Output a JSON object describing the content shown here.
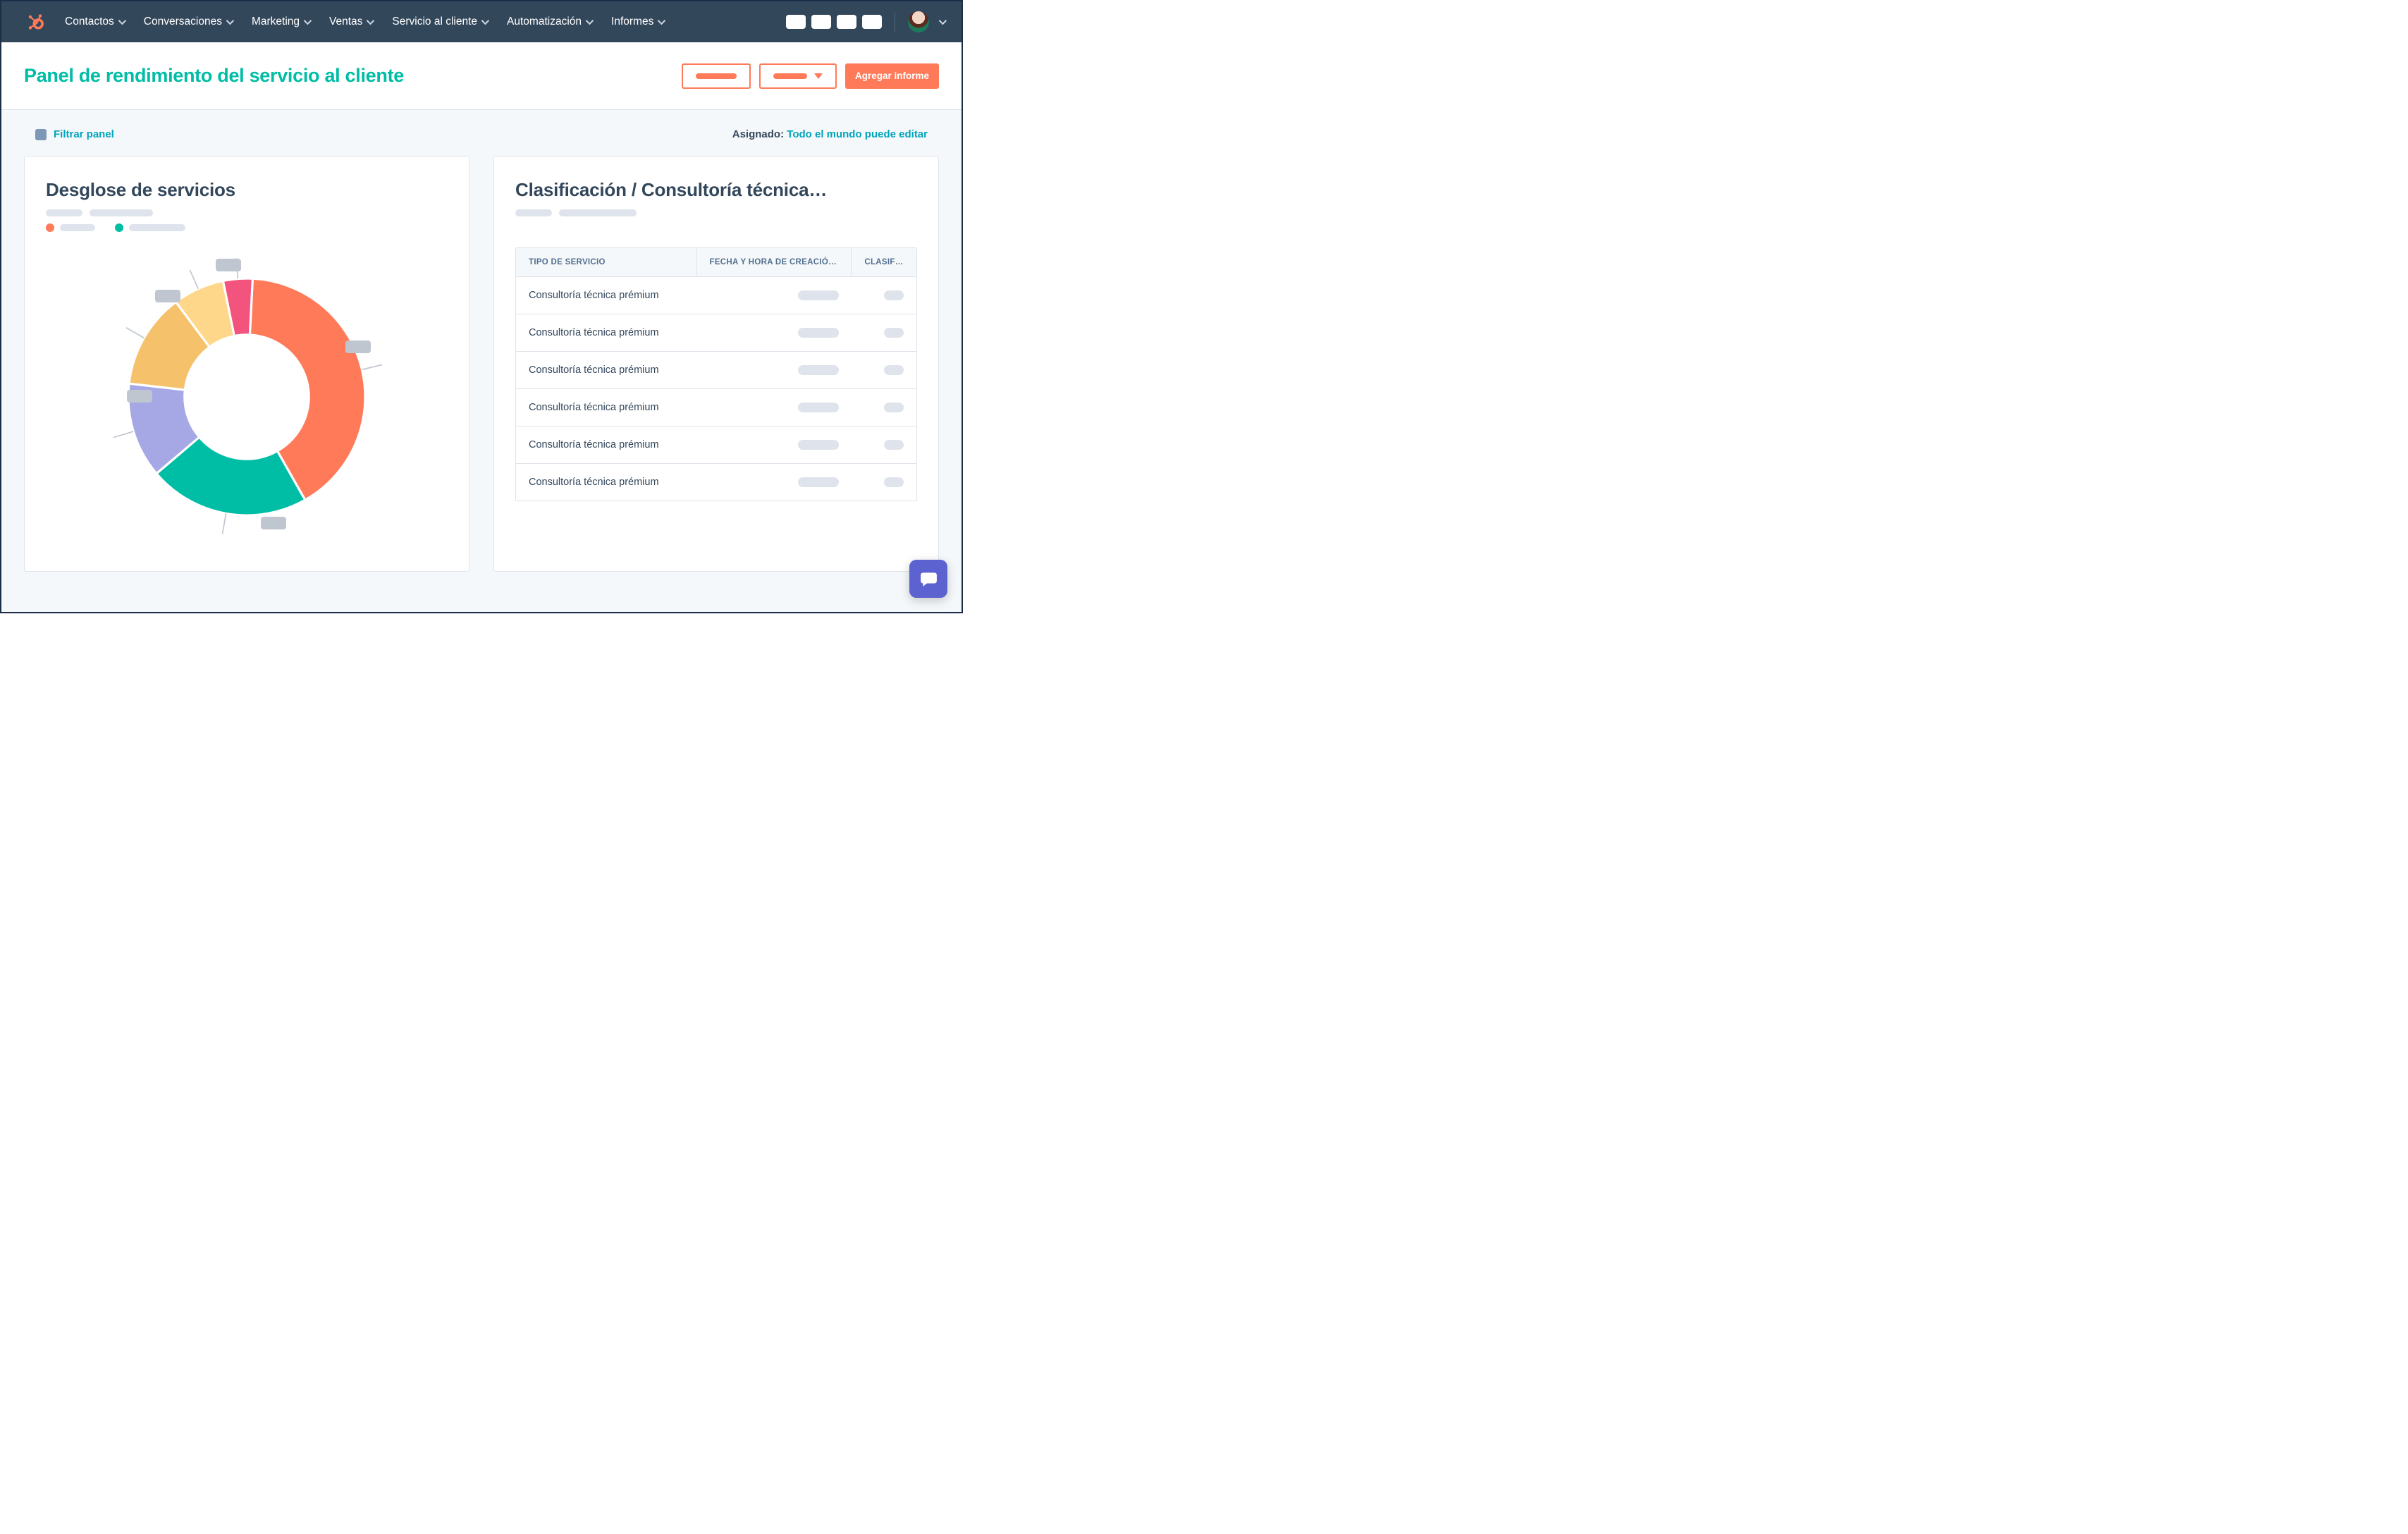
{
  "colors": {
    "accent": "#ff7a59",
    "teal": "#00bda5",
    "link": "#00a4bd",
    "navbg": "#33475b"
  },
  "nav": {
    "items": [
      {
        "label": "Contactos"
      },
      {
        "label": "Conversaciones"
      },
      {
        "label": "Marketing"
      },
      {
        "label": "Ventas"
      },
      {
        "label": "Servicio al cliente"
      },
      {
        "label": "Automatización"
      },
      {
        "label": "Informes"
      }
    ]
  },
  "page": {
    "title": "Panel de rendimiento del servicio al cliente",
    "add_report_label": "Agregar informe"
  },
  "surface": {
    "filter_label": "Filtrar panel",
    "assigned_key": "Asignado:",
    "assigned_value": "Todo el mundo puede editar"
  },
  "card_left": {
    "title": "Desglose de servicios"
  },
  "card_right": {
    "title": "Clasificación / Consultoría técnica…",
    "columns": [
      "TIPO DE SERVICIO",
      "FECHA Y HORA DE CREACIÓ…",
      "CLASIFI…"
    ],
    "rows": [
      {
        "service": "Consultoría técnica prémium"
      },
      {
        "service": "Consultoría técnica prémium"
      },
      {
        "service": "Consultoría técnica prémium"
      },
      {
        "service": "Consultoría técnica prémium"
      },
      {
        "service": "Consultoría técnica prémium"
      },
      {
        "service": "Consultoría técnica prémium"
      }
    ]
  },
  "chart_data": {
    "type": "pie",
    "title": "Desglose de servicios",
    "slices": [
      {
        "label": "",
        "value": 41,
        "color": "#ff7a59"
      },
      {
        "label": "",
        "value": 22,
        "color": "#00bda5"
      },
      {
        "label": "",
        "value": 13,
        "color": "#a6a8e5"
      },
      {
        "label": "",
        "value": 13,
        "color": "#f5c26b"
      },
      {
        "label": "",
        "value": 7,
        "color": "#ffd78a"
      },
      {
        "label": "",
        "value": 4,
        "color": "#f2547d"
      }
    ],
    "legend_colors": [
      "#ff7a59",
      "#00bda5"
    ]
  }
}
